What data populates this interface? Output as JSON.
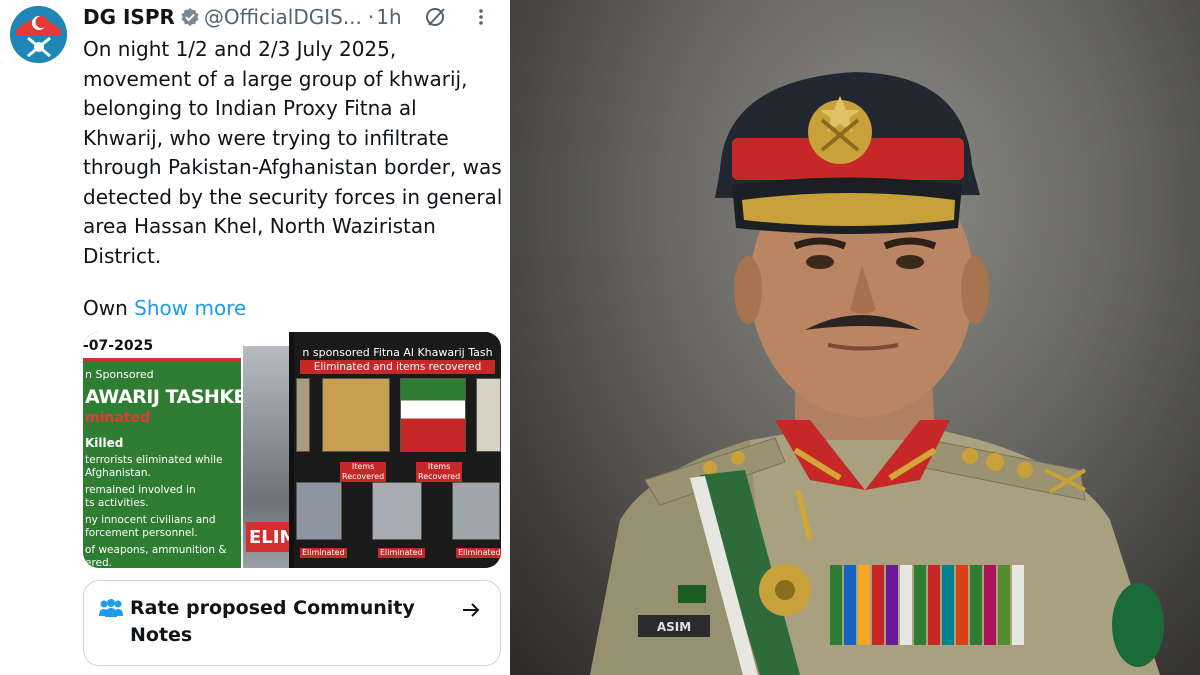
{
  "tweet": {
    "author_name": "DG ISPR",
    "handle": "@OfficialDGIS...",
    "separator": "·",
    "time": "1h",
    "text": "On night 1/2 and 2/3 July 2025, movement of a large group of khwarij, belonging to Indian Proxy Fitna al Khwarij, who were trying to infiltrate through Pakistan-Afghanistan border, was detected by the security forces in general area Hassan Khel, North Waziristan District.",
    "truncated_start": "Own",
    "show_more_label": "Show more",
    "icons": [
      "verified-badge-icon",
      "grok-icon",
      "more-options-icon"
    ]
  },
  "media_left": {
    "date": "-07-2025",
    "line1": "n Sponsored",
    "line2": "AWARIJ TASHKEEL",
    "line3": "minated",
    "line4": "Killed",
    "line5": "terrorists eliminated while\nAfghanistan.",
    "line6": "remained involved in\nts activities.",
    "line7": "ny innocent civilians and\nforcement personnel.",
    "line8": "of weapons, ammunition &\nered.",
    "badge": "ELIM"
  },
  "media_right": {
    "title": "n sponsored Fitna Al Khawarij Tash",
    "subtitle": "Eliminated and items recovered",
    "item_labels": [
      "Items\nRecovered",
      "Items\nRecovered"
    ],
    "eliminated_labels": [
      "Eliminated",
      "Eliminated",
      "Eliminated"
    ]
  },
  "community_notes": {
    "label": "Rate proposed Community Notes",
    "icon": "people-icon",
    "arrow": "arrow-right-icon"
  },
  "portrait": {
    "name_tag": "ASIM"
  },
  "colors": {
    "link": "#1d9bf0",
    "text_primary": "#0f1419",
    "text_secondary": "#536471",
    "border": "#cfd9de",
    "cap_band": "#c62828",
    "uniform_khaki": "#a8a07e"
  }
}
